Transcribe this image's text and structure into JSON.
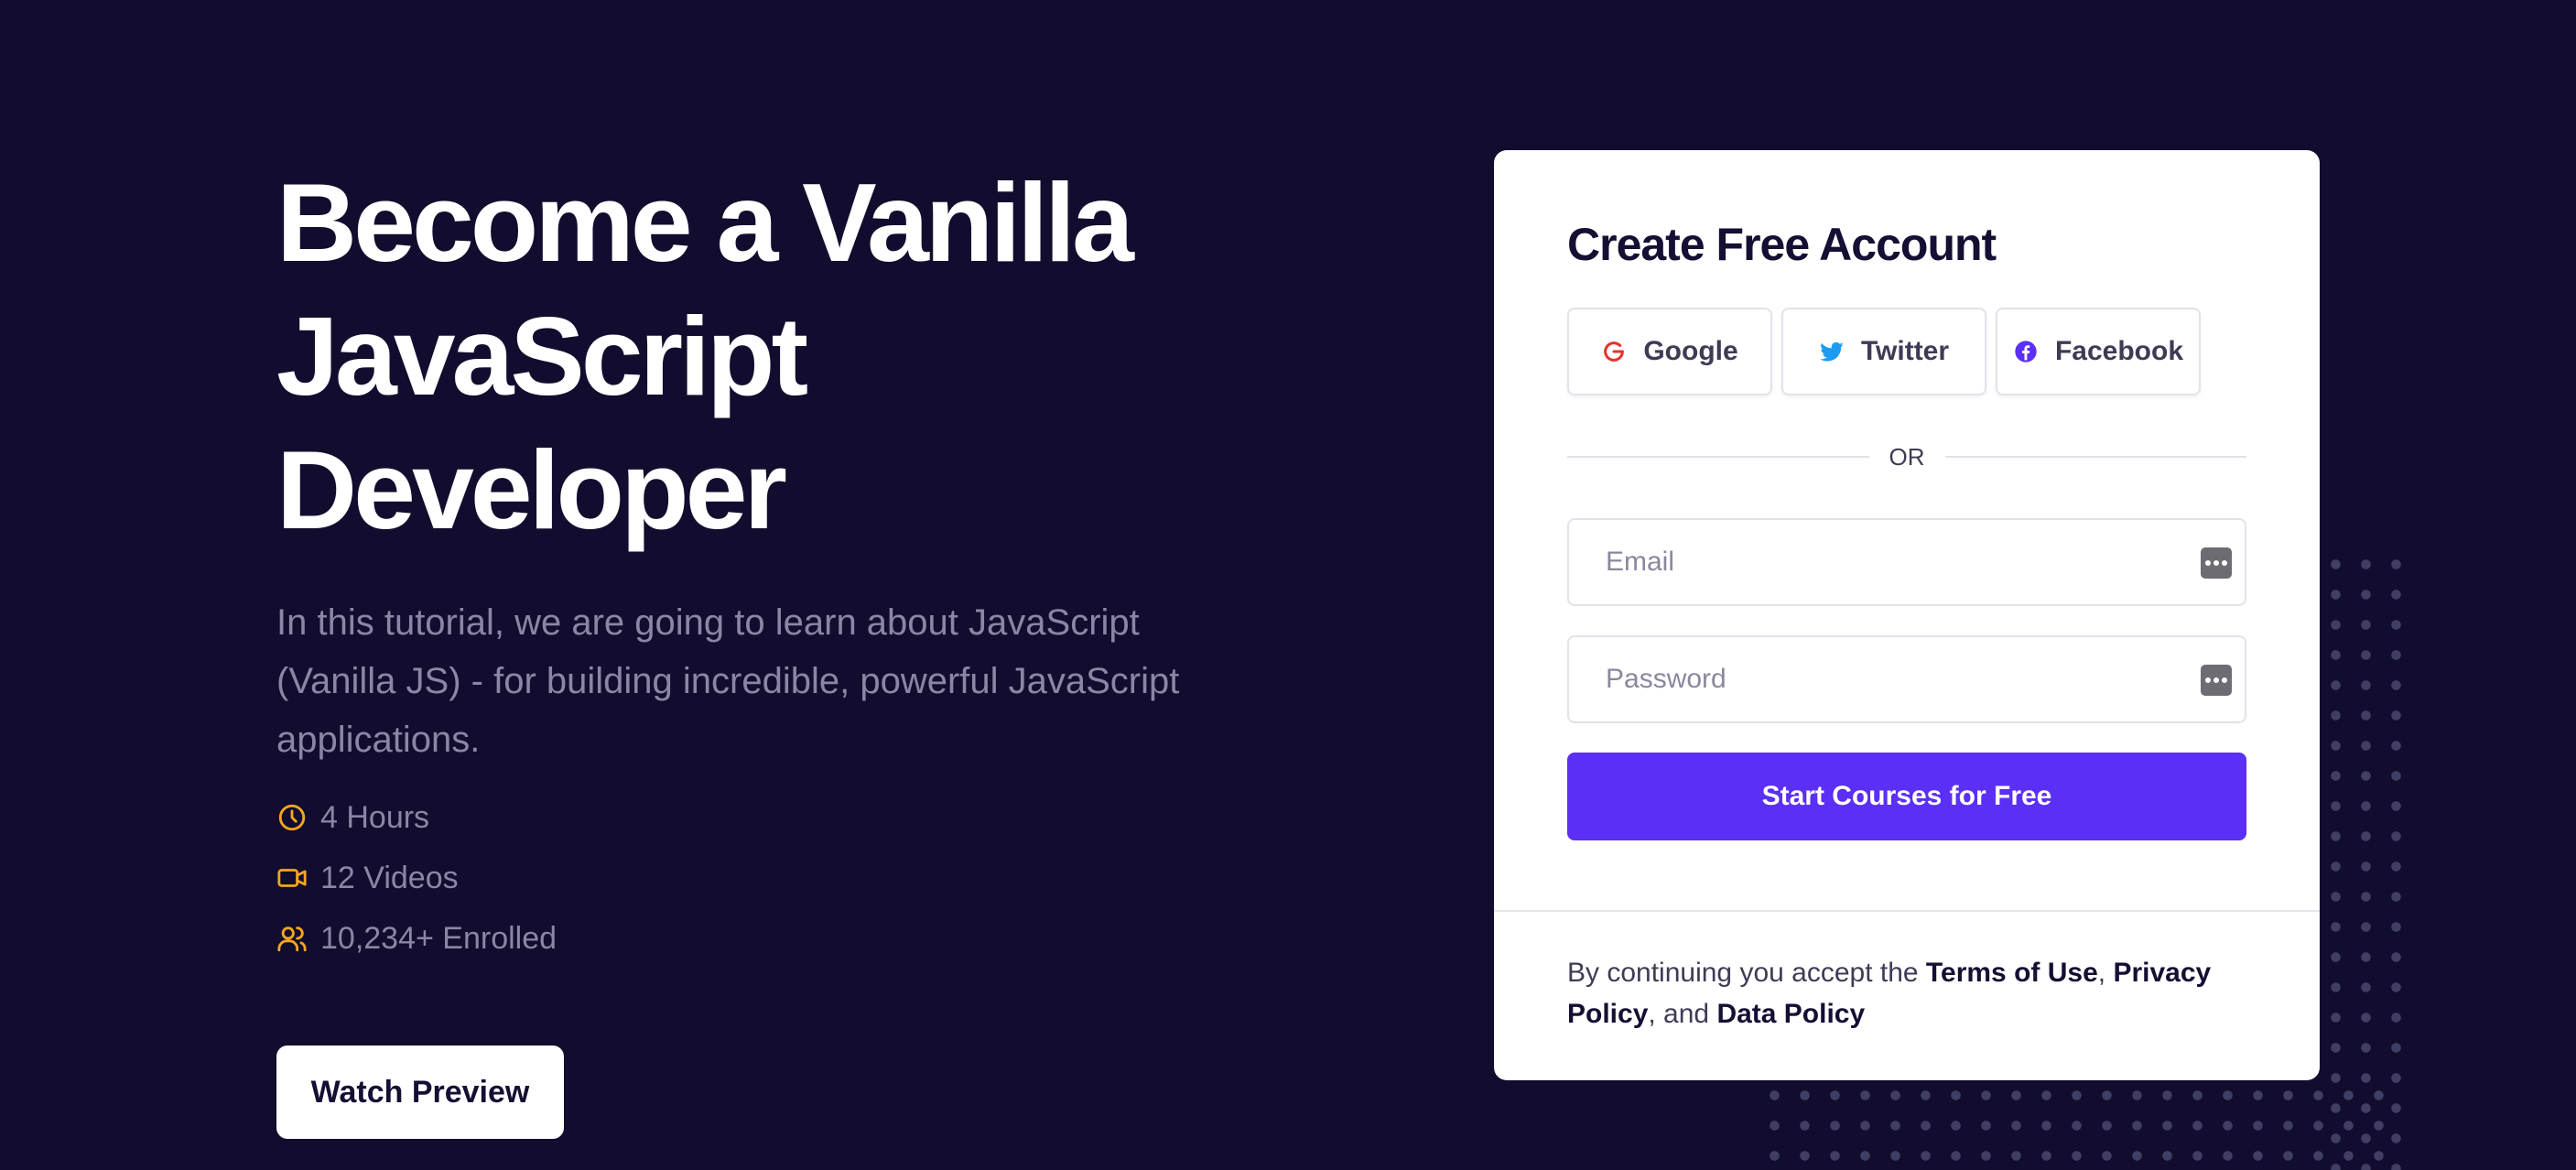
{
  "hero": {
    "title_line1": "Become a Vanilla",
    "title_line2": "JavaScript Developer",
    "description": "In this tutorial, we are going to learn about JavaScript (Vanilla JS) - for building incredible, powerful JavaScript applications.",
    "meta": [
      {
        "icon": "clock-icon",
        "text": "4 Hours"
      },
      {
        "icon": "video-icon",
        "text": "12 Videos"
      },
      {
        "icon": "users-icon",
        "text": "10,234+ Enrolled"
      }
    ],
    "watch_button": "Watch Preview"
  },
  "signup": {
    "title": "Create Free Account",
    "social": [
      {
        "label": "Google",
        "icon": "google-icon",
        "color": "#e5322d"
      },
      {
        "label": "Twitter",
        "icon": "twitter-icon",
        "color": "#1d9bf0"
      },
      {
        "label": "Facebook",
        "icon": "facebook-icon",
        "color": "#5b2ff6"
      }
    ],
    "divider": "OR",
    "email_placeholder": "Email",
    "password_placeholder": "Password",
    "submit": "Start Courses for Free",
    "legal": {
      "prefix": "By continuing you accept the ",
      "terms": "Terms of Use",
      "comma": ", ",
      "privacy": "Privacy Policy",
      "and": ", and ",
      "data_policy": "Data Policy"
    }
  },
  "colors": {
    "background": "#120d2e",
    "accent": "#5b2ff6",
    "meta_icon": "#f5a623",
    "muted_text": "#8c86a6"
  }
}
